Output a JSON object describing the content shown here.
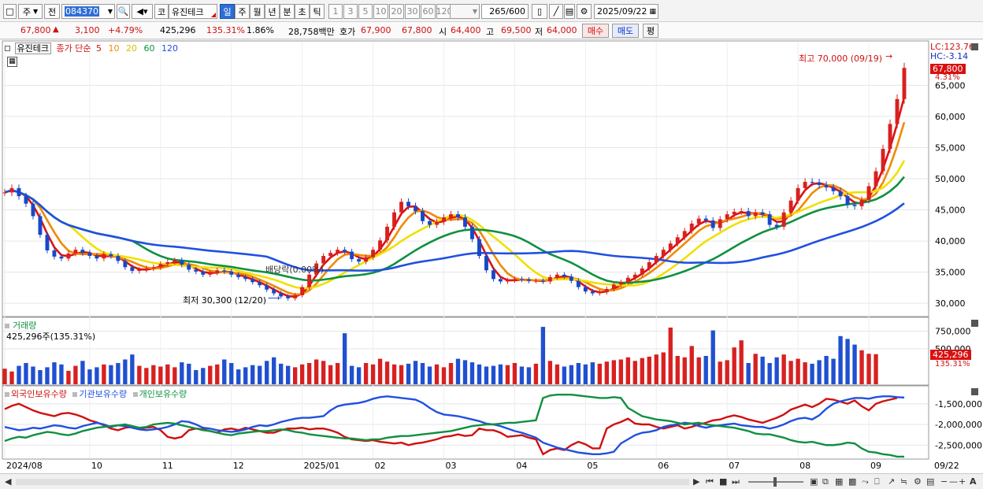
{
  "toolbar": {
    "market": "주",
    "prev_label": "전",
    "code": "084370",
    "market_tag": "코",
    "stock_name": "유진테크",
    "periods": [
      "일",
      "주",
      "월",
      "년",
      "분",
      "초",
      "틱"
    ],
    "active_period": "일",
    "intervals": [
      "1",
      "3",
      "5",
      "10",
      "20",
      "30",
      "60",
      "120"
    ],
    "count": "265",
    "count_total": "/600",
    "date": "2025/09/22"
  },
  "info": {
    "price": "67,800",
    "change": "3,100",
    "change_pct": "+4.79%",
    "volume": "425,296",
    "volume_ratio": "135.31%",
    "turnover": "1.86%",
    "amount": "28,758백만",
    "ask_label": "호가",
    "ask1": "67,900",
    "ask2": "67,800",
    "open_label": "시",
    "open": "64,400",
    "high_label": "고",
    "high": "69,500",
    "low_label": "저",
    "low": "64,000",
    "buy_label": "매수",
    "sell_label": "매도",
    "close_label": "평"
  },
  "price_panel": {
    "legend_name": "유진테크",
    "legend_ma": "종가 단순",
    "ma_periods": [
      "5",
      "10",
      "20",
      "60",
      "120"
    ],
    "ma_colors": [
      "#e01010",
      "#f08a00",
      "#f0e000",
      "#109040",
      "#2050e0"
    ],
    "lc_label": "LC:123.76",
    "hc_label": "HC:-3.14",
    "current_price_tag": "67,800",
    "current_pct_tag": "4.31%",
    "high_annotation": "최고 70,000 (09/19)",
    "low_annotation": "최저 30,300 (12/20)",
    "dividend_annotation": "배당락(0.00%)",
    "y_ticks": [
      "65,000",
      "60,000",
      "55,000",
      "50,000",
      "45,000",
      "40,000",
      "35,000",
      "30,000"
    ]
  },
  "volume_panel": {
    "title": "거래량",
    "value_label": "425,296주(135.31%)",
    "y_ticks": [
      "750,000",
      "500,000"
    ],
    "current_tag": "425,296",
    "current_pct": "135.31%"
  },
  "holding_panel": {
    "legend": [
      "외국인보유수량",
      "기관보유수량",
      "개인보유수량"
    ],
    "colors": [
      "#d01010",
      "#2050e0",
      "#109040"
    ],
    "y_ticks": [
      "-1,500,000",
      "-2,000,000",
      "-2,500,000"
    ]
  },
  "x_axis": {
    "labels": [
      "2024/08",
      "10",
      "11",
      "12",
      "2025/01",
      "02",
      "03",
      "04",
      "05",
      "06",
      "07",
      "08",
      "09"
    ],
    "end_label": "09/22"
  },
  "chart_data": {
    "type": "line",
    "title": "",
    "series_note": "",
    "ylim": [
      28000,
      72000
    ],
    "close": [
      47800,
      48500,
      47200,
      46000,
      44000,
      41000,
      38500,
      37500,
      37200,
      38000,
      38600,
      38100,
      37600,
      37200,
      37900,
      37600,
      36800,
      35800,
      35200,
      35400,
      35600,
      35800,
      36300,
      36600,
      36900,
      36200,
      35400,
      35100,
      34600,
      34900,
      35300,
      35100,
      34600,
      34200,
      33900,
      33400,
      32900,
      32200,
      31600,
      31100,
      30800,
      31300,
      32600,
      34600,
      36400,
      37600,
      38100,
      38600,
      38300,
      37100,
      36700,
      37400,
      38600,
      40100,
      42300,
      44600,
      46300,
      45600,
      44800,
      43200,
      42600,
      43100,
      43800,
      44300,
      43800,
      42300,
      40300,
      37600,
      35300,
      33900,
      33500,
      33700,
      33900,
      33800,
      33600,
      33600,
      33500,
      34200,
      34600,
      34300,
      33600,
      32600,
      31900,
      31600,
      31800,
      32300,
      33000,
      33400,
      34100,
      34600,
      35600,
      36600,
      37600,
      38600,
      39600,
      40600,
      41600,
      42800,
      43600,
      43300,
      42100,
      43500,
      44300,
      44700,
      44800,
      44000,
      44600,
      44300,
      42600,
      42300,
      44600,
      46500,
      48500,
      49500,
      49400,
      49000,
      48600,
      48000,
      47200,
      45800,
      45600,
      46600,
      48800,
      51200,
      54800,
      58800,
      62800,
      67800
    ],
    "ma_periods": [
      5,
      10,
      20,
      60,
      120
    ],
    "high_point": {
      "label": "최고 70,000 (09/19)",
      "value": 70000
    },
    "low_point": {
      "label": "최저 30,300 (12/20)",
      "value": 30300
    },
    "volume": [
      220,
      180,
      260,
      300,
      250,
      200,
      240,
      310,
      280,
      190,
      260,
      330,
      210,
      240,
      280,
      270,
      300,
      350,
      420,
      260,
      230,
      270,
      250,
      280,
      240,
      310,
      290,
      200,
      230,
      260,
      280,
      350,
      300,
      210,
      240,
      270,
      260,
      330,
      380,
      290,
      260,
      240,
      280,
      300,
      350,
      330,
      270,
      300,
      720,
      260,
      240,
      300,
      280,
      360,
      320,
      280,
      270,
      290,
      330,
      300,
      250,
      280,
      240,
      300,
      360,
      340,
      310,
      280,
      250,
      260,
      280,
      270,
      300,
      250,
      240,
      290,
      810,
      330,
      280,
      250,
      270,
      300,
      280,
      310,
      290,
      320,
      340,
      350,
      380,
      330,
      370,
      390,
      420,
      450,
      800,
      400,
      380,
      540,
      380,
      400,
      760,
      320,
      340,
      520,
      620,
      300,
      430,
      390,
      300,
      380,
      420,
      330,
      360,
      310,
      290,
      340,
      400,
      360,
      680,
      640,
      560,
      480,
      430,
      425
    ],
    "foreign": [
      -1.63,
      -1.55,
      -1.5,
      -1.58,
      -1.66,
      -1.72,
      -1.76,
      -1.8,
      -1.74,
      -1.72,
      -1.76,
      -1.82,
      -1.9,
      -1.95,
      -2.02,
      -2.1,
      -2.14,
      -2.08,
      -2.06,
      -2.1,
      -2.08,
      -2.06,
      -2.14,
      -2.3,
      -2.34,
      -2.3,
      -2.14,
      -2.1,
      -2.12,
      -2.16,
      -2.2,
      -2.12,
      -2.1,
      -2.14,
      -2.08,
      -2.12,
      -2.16,
      -2.2,
      -2.2,
      -2.14,
      -2.1,
      -2.1,
      -2.08,
      -2.12,
      -2.1,
      -2.1,
      -2.14,
      -2.2,
      -2.3,
      -2.36,
      -2.38,
      -2.4,
      -2.38,
      -2.42,
      -2.44,
      -2.46,
      -2.44,
      -2.5,
      -2.46,
      -2.44,
      -2.4,
      -2.36,
      -2.3,
      -2.28,
      -2.24,
      -2.28,
      -2.26,
      -2.1,
      -2.14,
      -2.14,
      -2.2,
      -2.3,
      -2.28,
      -2.26,
      -2.32,
      -2.36,
      -2.72,
      -2.62,
      -2.58,
      -2.62,
      -2.5,
      -2.42,
      -2.48,
      -2.58,
      -2.58,
      -2.1,
      -2.0,
      -1.94,
      -1.86,
      -1.98,
      -2.0,
      -2.0,
      -2.06,
      -2.1,
      -2.06,
      -2.02,
      -2.1,
      -2.06,
      -2.0,
      -1.96,
      -1.9,
      -1.88,
      -1.82,
      -1.78,
      -1.82,
      -1.88,
      -1.92,
      -1.96,
      -1.9,
      -1.84,
      -1.76,
      -1.64,
      -1.58,
      -1.52,
      -1.58,
      -1.5,
      -1.38,
      -1.4,
      -1.45,
      -1.5,
      -1.42,
      -1.56,
      -1.66,
      -1.5,
      -1.44,
      -1.4,
      -1.36
    ],
    "institution": [
      -2.06,
      -2.1,
      -2.14,
      -2.12,
      -2.08,
      -2.1,
      -2.06,
      -2.02,
      -2.04,
      -2.08,
      -2.1,
      -2.04,
      -2.0,
      -1.96,
      -2.0,
      -2.06,
      -2.02,
      -2.04,
      -2.08,
      -2.12,
      -2.14,
      -2.12,
      -2.1,
      -2.06,
      -2.0,
      -1.92,
      -1.94,
      -2.0,
      -2.08,
      -2.1,
      -2.14,
      -2.16,
      -2.18,
      -2.16,
      -2.12,
      -2.06,
      -2.02,
      -2.04,
      -2.0,
      -1.94,
      -1.9,
      -1.86,
      -1.84,
      -1.84,
      -1.82,
      -1.8,
      -1.66,
      -1.56,
      -1.52,
      -1.5,
      -1.48,
      -1.44,
      -1.38,
      -1.34,
      -1.32,
      -1.34,
      -1.36,
      -1.38,
      -1.4,
      -1.48,
      -1.6,
      -1.7,
      -1.76,
      -1.78,
      -1.8,
      -1.84,
      -1.88,
      -1.92,
      -1.98,
      -2.0,
      -2.04,
      -2.1,
      -2.16,
      -2.2,
      -2.26,
      -2.32,
      -2.44,
      -2.5,
      -2.56,
      -2.6,
      -2.64,
      -2.68,
      -2.7,
      -2.72,
      -2.72,
      -2.7,
      -2.66,
      -2.46,
      -2.36,
      -2.26,
      -2.2,
      -2.18,
      -2.14,
      -2.06,
      -2.02,
      -2.0,
      -1.96,
      -1.98,
      -2.04,
      -2.08,
      -2.04,
      -2.02,
      -2.0,
      -1.98,
      -2.02,
      -2.04,
      -2.06,
      -2.06,
      -2.1,
      -2.06,
      -2.0,
      -1.92,
      -1.86,
      -1.84,
      -1.88,
      -1.78,
      -1.62,
      -1.5,
      -1.44,
      -1.4,
      -1.36,
      -1.36,
      -1.38,
      -1.34,
      -1.32,
      -1.32,
      -1.34,
      -1.35
    ],
    "individual": [
      -2.4,
      -2.34,
      -2.3,
      -2.32,
      -2.26,
      -2.22,
      -2.18,
      -2.2,
      -2.24,
      -2.26,
      -2.22,
      -2.16,
      -2.12,
      -2.08,
      -2.06,
      -2.04,
      -2.02,
      -2.0,
      -2.04,
      -2.08,
      -2.06,
      -2.0,
      -1.98,
      -1.96,
      -1.98,
      -2.02,
      -2.06,
      -2.1,
      -2.14,
      -2.16,
      -2.2,
      -2.24,
      -2.26,
      -2.22,
      -2.2,
      -2.18,
      -2.16,
      -2.16,
      -2.14,
      -2.12,
      -2.14,
      -2.18,
      -2.2,
      -2.24,
      -2.26,
      -2.28,
      -2.3,
      -2.32,
      -2.34,
      -2.34,
      -2.36,
      -2.38,
      -2.36,
      -2.36,
      -2.32,
      -2.3,
      -2.28,
      -2.28,
      -2.26,
      -2.24,
      -2.22,
      -2.2,
      -2.18,
      -2.16,
      -2.12,
      -2.08,
      -2.04,
      -2.02,
      -2.0,
      -2.0,
      -1.98,
      -1.96,
      -1.96,
      -1.94,
      -1.92,
      -1.9,
      -1.36,
      -1.3,
      -1.28,
      -1.28,
      -1.28,
      -1.3,
      -1.32,
      -1.34,
      -1.36,
      -1.36,
      -1.34,
      -1.36,
      -1.6,
      -1.7,
      -1.8,
      -1.84,
      -1.88,
      -1.9,
      -1.92,
      -1.96,
      -2.0,
      -1.98,
      -1.96,
      -2.0,
      -2.02,
      -2.04,
      -2.06,
      -2.08,
      -2.12,
      -2.16,
      -2.22,
      -2.24,
      -2.24,
      -2.28,
      -2.32,
      -2.38,
      -2.42,
      -2.44,
      -2.42,
      -2.46,
      -2.5,
      -2.5,
      -2.48,
      -2.44,
      -2.46,
      -2.58,
      -2.66,
      -2.68,
      -2.72,
      -2.74,
      -2.78,
      -2.78
    ]
  }
}
